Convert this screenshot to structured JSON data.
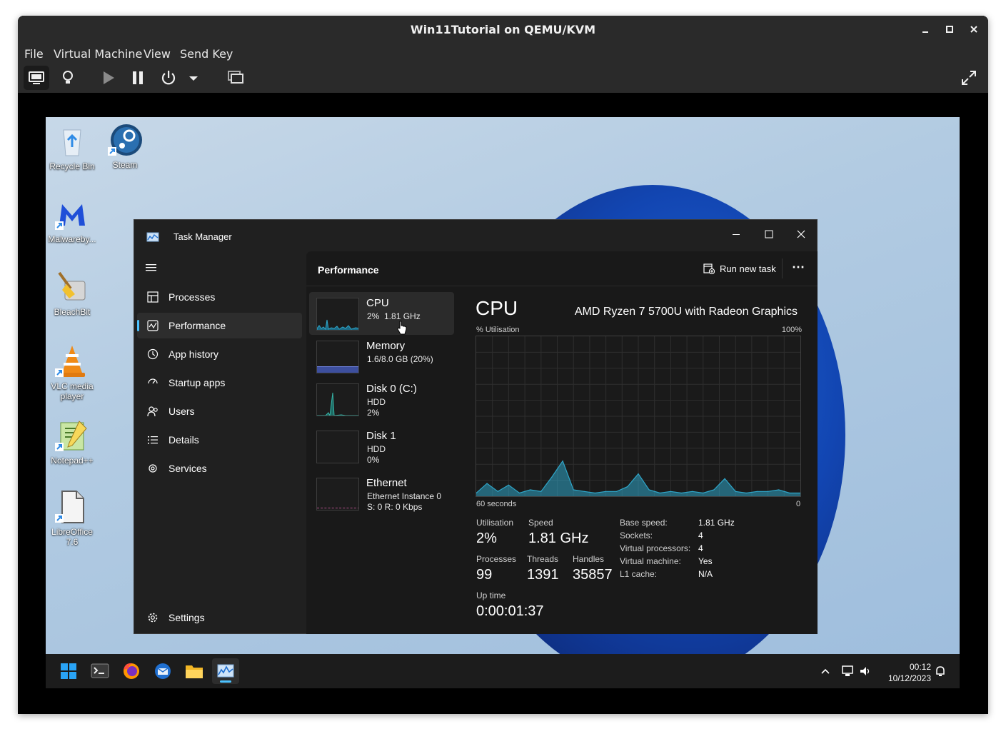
{
  "vm": {
    "title": "Win11Tutorial on QEMU/KVM",
    "menu": [
      "File",
      "Virtual Machine",
      "View",
      "Send Key"
    ]
  },
  "desktop_icons": [
    {
      "label": "Recycle Bin",
      "icon": "recycle-bin-icon"
    },
    {
      "label": "Steam",
      "icon": "steam-icon"
    },
    {
      "label": "Malwareby...",
      "icon": "malwarebytes-icon"
    },
    {
      "label": "BleachBit",
      "icon": "bleachbit-icon"
    },
    {
      "label": "VLC media player",
      "icon": "vlc-icon"
    },
    {
      "label": "Notepad++",
      "icon": "notepadpp-icon"
    },
    {
      "label": "LibreOffice 7.6",
      "icon": "libreoffice-icon"
    }
  ],
  "task_manager": {
    "title": "Task Manager",
    "nav": {
      "items": [
        "Processes",
        "Performance",
        "App history",
        "Startup apps",
        "Users",
        "Details",
        "Services"
      ],
      "selected": "Performance",
      "settings": "Settings"
    },
    "header": {
      "title": "Performance",
      "run_new_task": "Run new task",
      "more": "⋯"
    },
    "devices": [
      {
        "name": "CPU",
        "line1": "2%  1.81 GHz",
        "line2": ""
      },
      {
        "name": "Memory",
        "line1": "1.6/8.0 GB (20%)",
        "line2": ""
      },
      {
        "name": "Disk 0 (C:)",
        "line1": "HDD",
        "line2": "2%"
      },
      {
        "name": "Disk 1",
        "line1": "HDD",
        "line2": "0%"
      },
      {
        "name": "Ethernet",
        "line1": "Ethernet Instance 0",
        "line2": "S: 0 R: 0 Kbps"
      }
    ],
    "cpu": {
      "title": "CPU",
      "model": "AMD Ryzen 7 5700U with Radeon Graphics",
      "graph_label": "% Utilisation",
      "graph_max": "100%",
      "graph_time": "60 seconds",
      "graph_min": "0",
      "utilisation_label": "Utilisation",
      "utilisation": "2%",
      "speed_label": "Speed",
      "speed": "1.81 GHz",
      "processes_label": "Processes",
      "processes": "99",
      "threads_label": "Threads",
      "threads": "1391",
      "handles_label": "Handles",
      "handles": "35857",
      "uptime_label": "Up time",
      "uptime": "0:00:01:37",
      "details": [
        {
          "k": "Base speed:",
          "v": "1.81 GHz"
        },
        {
          "k": "Sockets:",
          "v": "4"
        },
        {
          "k": "Virtual processors:",
          "v": "4"
        },
        {
          "k": "Virtual machine:",
          "v": "Yes"
        },
        {
          "k": "L1 cache:",
          "v": "N/A"
        }
      ]
    }
  },
  "chart_data": {
    "type": "area",
    "x": [
      0,
      2,
      4,
      6,
      8,
      10,
      12,
      14,
      16,
      18,
      20,
      22,
      24,
      26,
      28,
      30,
      32,
      34,
      36,
      38,
      40,
      42,
      44,
      46,
      48,
      50,
      52,
      54,
      56,
      58,
      60
    ],
    "values": [
      2,
      8,
      3,
      7,
      2,
      4,
      3,
      12,
      22,
      4,
      3,
      2,
      3,
      3,
      6,
      14,
      4,
      2,
      3,
      2,
      3,
      2,
      4,
      11,
      3,
      2,
      3,
      3,
      4,
      2,
      2
    ],
    "xlabel": "60 seconds",
    "ylabel": "% Utilisation",
    "ylim": [
      0,
      100
    ],
    "grid": true,
    "color": "#2fa6c9"
  },
  "taskbar": {
    "apps": [
      "start-icon",
      "terminal-icon",
      "firefox-icon",
      "thunderbird-icon",
      "file-explorer-icon",
      "task-manager-icon"
    ],
    "time": "00:12",
    "date": "10/12/2023"
  },
  "colors": {
    "accent": "#4cc2ff",
    "graph": "#2fa6c9",
    "memory": "#5b6dc9"
  }
}
